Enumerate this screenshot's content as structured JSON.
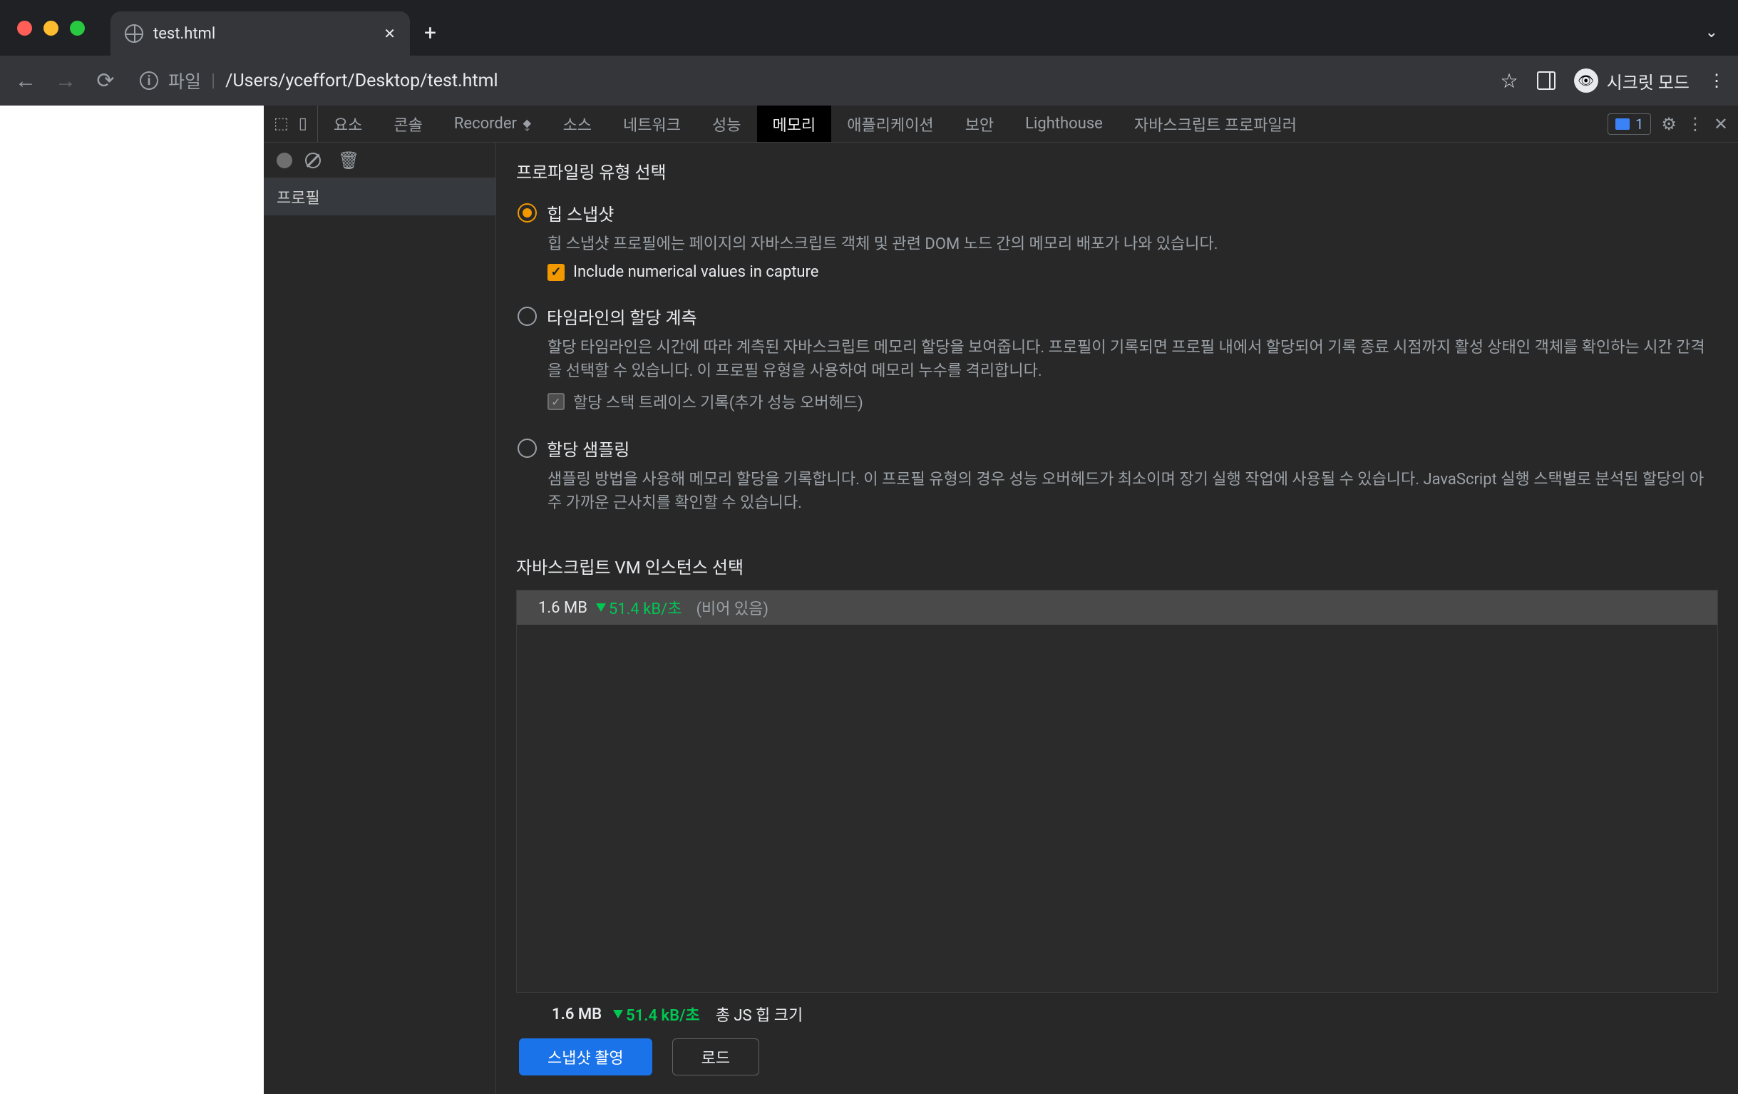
{
  "browser": {
    "tab_title": "test.html",
    "address_label": "파일",
    "address_path": "/Users/yceffort/Desktop/test.html",
    "incognito_label": "시크릿 모드"
  },
  "devtools": {
    "tabs": {
      "elements": "요소",
      "console": "콘솔",
      "recorder": "Recorder",
      "sources": "소스",
      "network": "네트워크",
      "performance": "성능",
      "memory": "메모리",
      "application": "애플리케이션",
      "security": "보안",
      "lighthouse": "Lighthouse",
      "profiler": "자바스크립트 프로파일러"
    },
    "issues_count": "1",
    "sidebar": {
      "profile": "프로필"
    },
    "section_title": "프로파일링 유형 선택",
    "options": {
      "heap": {
        "title": "힙 스냅샷",
        "desc": "힙 스냅샷 프로필에는 페이지의 자바스크립트 객체 및 관련 DOM 노드 간의 메모리 배포가 나와 있습니다.",
        "checkbox": "Include numerical values in capture"
      },
      "timeline": {
        "title": "타임라인의 할당 계측",
        "desc": "할당 타임라인은 시간에 따라 계측된 자바스크립트 메모리 할당을 보여줍니다. 프로필이 기록되면 프로필 내에서 할당되어 기록 종료 시점까지 활성 상태인 객체를 확인하는 시간 간격을 선택할 수 있습니다. 이 프로필 유형을 사용하여 메모리 누수를 격리합니다.",
        "checkbox": "할당 스택 트레이스 기록(추가 성능 오버헤드)"
      },
      "sampling": {
        "title": "할당 샘플링",
        "desc": "샘플링 방법을 사용해 메모리 할당을 기록합니다. 이 프로필 유형의 경우 성능 오버헤드가 최소이며 장기 실행 작업에 사용될 수 있습니다. JavaScript 실행 스택별로 분석된 할당의 아주 가까운 근사치를 확인할 수 있습니다."
      }
    },
    "vm": {
      "title": "자바스크립트 VM 인스턴스 선택",
      "row": {
        "size": "1.6 MB",
        "rate": "51.4 kB/초",
        "label": "(비어 있음)"
      },
      "total": {
        "size": "1.6 MB",
        "rate": "51.4 kB/초",
        "label": "총 JS 힙 크기"
      }
    },
    "buttons": {
      "snapshot": "스냅샷 촬영",
      "load": "로드"
    }
  }
}
